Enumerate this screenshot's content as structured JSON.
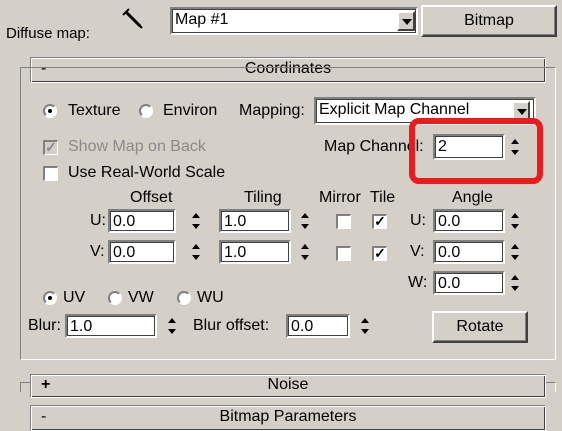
{
  "diffuse": {
    "label": "Diffuse map:",
    "map_name": "Map #1",
    "type_button": "Bitmap"
  },
  "rollouts": {
    "coordinates": {
      "sign": "-",
      "title": "Coordinates"
    },
    "noise": {
      "sign": "+",
      "title": "Noise"
    },
    "bitmap_params": {
      "sign": "-",
      "title": "Bitmap Parameters"
    }
  },
  "coords": {
    "texture_label": "Texture",
    "environ_label": "Environ",
    "mapping_label": "Mapping:",
    "mapping_value": "Explicit Map Channel",
    "show_map_on_back": "Show Map on Back",
    "use_real_world_scale": "Use Real-World Scale",
    "map_channel_label": "Map Channel:",
    "map_channel_value": "2",
    "headers": {
      "offset": "Offset",
      "tiling": "Tiling",
      "mirror": "Mirror",
      "tile": "Tile",
      "angle": "Angle"
    },
    "u_label": "U:",
    "v_label": "V:",
    "w_label": "W:",
    "u_offset": "0.0",
    "v_offset": "0.0",
    "u_tiling": "1.0",
    "v_tiling": "1.0",
    "u_angle": "0.0",
    "v_angle": "0.0",
    "w_angle": "0.0",
    "uv_label": "UV",
    "vw_label": "VW",
    "wu_label": "WU",
    "blur_label": "Blur:",
    "blur_value": "1.0",
    "blur_offset_label": "Blur offset:",
    "blur_offset_value": "0.0",
    "rotate_button": "Rotate",
    "check_mark": "✓"
  },
  "colors": {
    "panel": "#d4d0c8",
    "highlight": "#e81c1c"
  }
}
